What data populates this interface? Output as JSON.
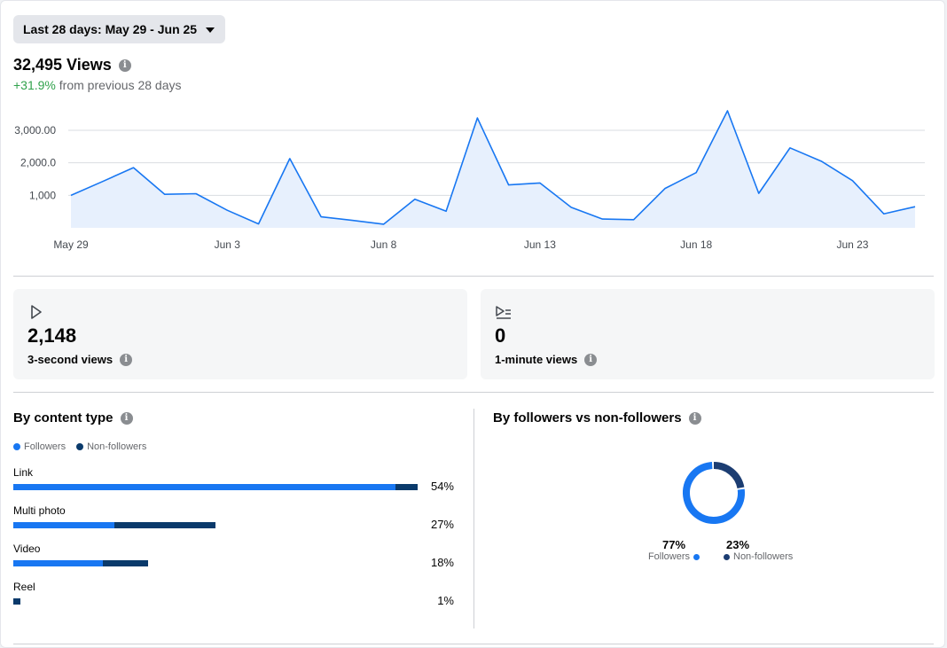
{
  "date_range": {
    "label": "Last 28 days: May 29 - Jun 25"
  },
  "summary": {
    "views": "32,495 Views",
    "delta_value": "+31.9%",
    "delta_text": "from previous 28 days"
  },
  "chart_data": {
    "type": "area",
    "x_tick_labels": [
      "May 29",
      "Jun 3",
      "Jun 8",
      "Jun 13",
      "Jun 18",
      "Jun 23"
    ],
    "y_tick_labels": [
      "1,000",
      "2,000.0",
      "3,000.00"
    ],
    "ylim": [
      0,
      3000
    ],
    "grid": true,
    "x": [
      "May 29",
      "May 30",
      "May 31",
      "Jun 1",
      "Jun 2",
      "Jun 3",
      "Jun 4",
      "Jun 5",
      "Jun 6",
      "Jun 7",
      "Jun 8",
      "Jun 9",
      "Jun 10",
      "Jun 11",
      "Jun 12",
      "Jun 13",
      "Jun 14",
      "Jun 15",
      "Jun 16",
      "Jun 17",
      "Jun 18",
      "Jun 19",
      "Jun 20",
      "Jun 21",
      "Jun 22",
      "Jun 23",
      "Jun 24",
      "Jun 25"
    ],
    "values": [
      1000,
      1420,
      1850,
      1030,
      1050,
      540,
      120,
      2130,
      340,
      230,
      110,
      880,
      510,
      3380,
      1320,
      1380,
      630,
      270,
      250,
      1210,
      1700,
      3600,
      1060,
      2460,
      2050,
      1450,
      430,
      650
    ],
    "colors": {
      "line": "#1877f2",
      "fill": "#e7f0fd",
      "grid": "#dadde1"
    }
  },
  "metrics": [
    {
      "icon": "play-icon",
      "value": "2,148",
      "label": "3-second views"
    },
    {
      "icon": "play-list-icon",
      "value": "0",
      "label": "1-minute views"
    }
  ],
  "content_type": {
    "title": "By content type",
    "legend": {
      "followers": "Followers",
      "non_followers": "Non-followers"
    },
    "rows": [
      {
        "label": "Link",
        "pct": "54%",
        "followers": 51,
        "non_followers": 3
      },
      {
        "label": "Multi photo",
        "pct": "27%",
        "followers": 13.5,
        "non_followers": 13.5
      },
      {
        "label": "Video",
        "pct": "18%",
        "followers": 12,
        "non_followers": 6
      },
      {
        "label": "Reel",
        "pct": "1%",
        "followers": 0,
        "non_followers": 1
      }
    ]
  },
  "followers_split": {
    "title": "By followers vs non-followers",
    "followers": {
      "pct": "77%",
      "label": "Followers",
      "value": 0.77
    },
    "non_followers": {
      "pct": "23%",
      "label": "Non-followers",
      "value": 0.23
    },
    "colors": {
      "followers": "#1877f2",
      "non_followers": "#1c3d72"
    }
  }
}
